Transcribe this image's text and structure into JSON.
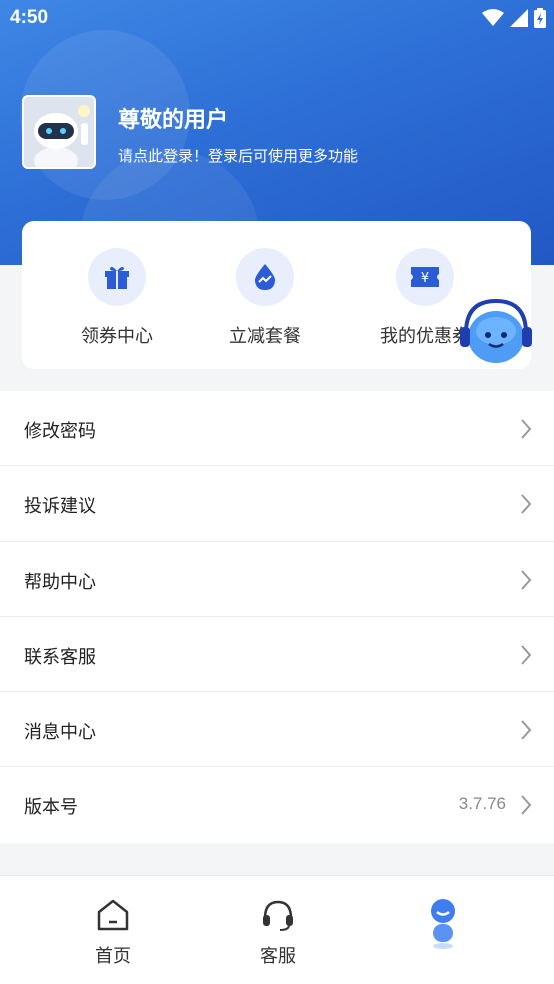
{
  "status_bar": {
    "time": "4:50"
  },
  "user": {
    "name": "尊敬的用户",
    "hint": "请点此登录！登录后可使用更多功能"
  },
  "quick_actions": [
    {
      "label": "领券中心",
      "icon": "gift-icon"
    },
    {
      "label": "立减套餐",
      "icon": "drop-chart-icon"
    },
    {
      "label": "我的优惠券",
      "icon": "yuan-ticket-icon"
    }
  ],
  "menu": [
    {
      "label": "修改密码"
    },
    {
      "label": "投诉建议"
    },
    {
      "label": "帮助中心"
    },
    {
      "label": "联系客服"
    },
    {
      "label": "消息中心"
    },
    {
      "label": "版本号",
      "value": "3.7.76"
    }
  ],
  "tabbar": [
    {
      "label": "首页",
      "icon": "home-icon"
    },
    {
      "label": "客服",
      "icon": "headset-icon"
    },
    {
      "label": "",
      "icon": "mascot-icon",
      "active": true
    }
  ],
  "colors": {
    "header_blue": "#2d6fd6",
    "icon_blue": "#2b5bd7",
    "icon_bg": "#e8eefb"
  }
}
